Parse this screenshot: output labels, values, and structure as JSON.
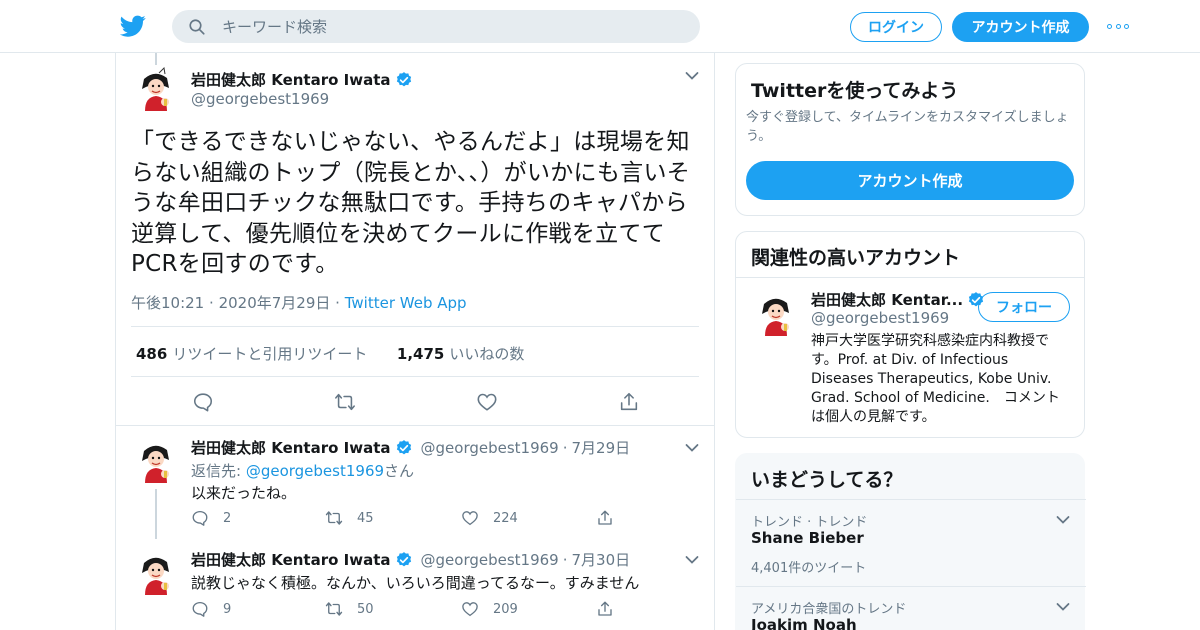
{
  "header": {
    "search_placeholder": "キーワード検索",
    "login_label": "ログイン",
    "signup_label": "アカウント作成"
  },
  "main_tweet": {
    "author_name": "岩田健太郎 Kentaro Iwata",
    "author_handle": "@georgebest1969",
    "text": "「できるできないじゃない、やるんだよ」は現場を知らない組織のトップ（院長とか、、）がいかにも言いそうな牟田口チックな無駄口です。手持ちのキャパから逆算して、優先順位を決めてクールに作戦を立ててPCRを回すのです。",
    "time": "午後10:21",
    "date": "2020年7月29日",
    "source": "Twitter Web App",
    "sep": "·",
    "retweets_count": "486",
    "retweets_label": "リツイートと引用リツイート",
    "likes_count": "1,475",
    "likes_label": "いいねの数"
  },
  "replies": [
    {
      "author_name": "岩田健太郎 Kentaro Iwata",
      "author_handle": "@georgebest1969",
      "date": "7月29日",
      "reply_to_label": "返信先: ",
      "reply_to_handle": "@georgebest1969",
      "reply_to_suffix": "さん",
      "text": "以来だったね。",
      "replies": "2",
      "retweets": "45",
      "likes": "224"
    },
    {
      "author_name": "岩田健太郎 Kentaro Iwata",
      "author_handle": "@georgebest1969",
      "date": "7月30日",
      "text": "説教じゃなく積極。なんか、いろいろ間違ってるなー。すみません",
      "replies": "9",
      "retweets": "50",
      "likes": "209"
    }
  ],
  "sidebar": {
    "signup_card": {
      "title": "Twitterを使ってみよう",
      "description": "今すぐ登録して、タイムラインをカスタマイズしましょう。",
      "button_label": "アカウント作成"
    },
    "related": {
      "title": "関連性の高いアカウント",
      "account_name": "岩田健太郎 Kentar...",
      "account_handle": "@georgebest1969",
      "follow_label": "フォロー",
      "bio": "神戸大学医学研究科感染症内科教授です。Prof. at Div. of Infectious Diseases Therapeutics, Kobe Univ. Grad. School of Medicine.　コメントは個人の見解です。"
    },
    "trends": {
      "title": "いまどうしてる？",
      "items": [
        {
          "context": "トレンド · トレンド",
          "name": "Shane Bieber",
          "count": "4,401件のツイート"
        },
        {
          "context": "アメリカ合衆国のトレンド",
          "name": "Joakim Noah",
          "count": ""
        }
      ]
    }
  },
  "colors": {
    "brand": "#1da1f2",
    "link": "#1b95e0",
    "secondary_text": "#657786",
    "border": "#e1e8ed"
  }
}
